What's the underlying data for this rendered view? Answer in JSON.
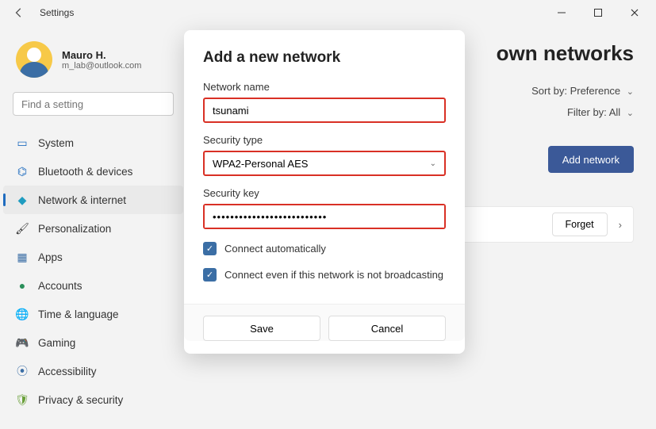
{
  "titlebar": {
    "title": "Settings"
  },
  "profile": {
    "name": "Mauro H.",
    "email": "m_lab@outlook.com"
  },
  "search": {
    "placeholder": "Find a setting"
  },
  "nav": {
    "items": [
      {
        "label": "System",
        "icon": "🖥️"
      },
      {
        "label": "Bluetooth & devices",
        "icon": "ᚼ"
      },
      {
        "label": "Network & internet",
        "icon": "◆",
        "active": true
      },
      {
        "label": "Personalization",
        "icon": "🖌"
      },
      {
        "label": "Apps",
        "icon": "▦"
      },
      {
        "label": "Accounts",
        "icon": "👤"
      },
      {
        "label": "Time & language",
        "icon": "🌐"
      },
      {
        "label": "Gaming",
        "icon": "🎮"
      },
      {
        "label": "Accessibility",
        "icon": "♿"
      },
      {
        "label": "Privacy & security",
        "icon": "🛡"
      }
    ]
  },
  "page": {
    "title_visible": "own networks",
    "sort_label": "Sort by:",
    "sort_value": "Preference",
    "filter_label": "Filter by:",
    "filter_value": "All",
    "add_button": "Add network",
    "forget_button": "Forget"
  },
  "dialog": {
    "title": "Add a new network",
    "network_name_label": "Network name",
    "network_name_value": "tsunami",
    "security_type_label": "Security type",
    "security_type_value": "WPA2-Personal AES",
    "security_key_label": "Security key",
    "security_key_value": "••••••••••••••••••••••••••",
    "connect_auto_label": "Connect automatically",
    "connect_hidden_label": "Connect even if this network is not broadcasting",
    "save": "Save",
    "cancel": "Cancel"
  }
}
